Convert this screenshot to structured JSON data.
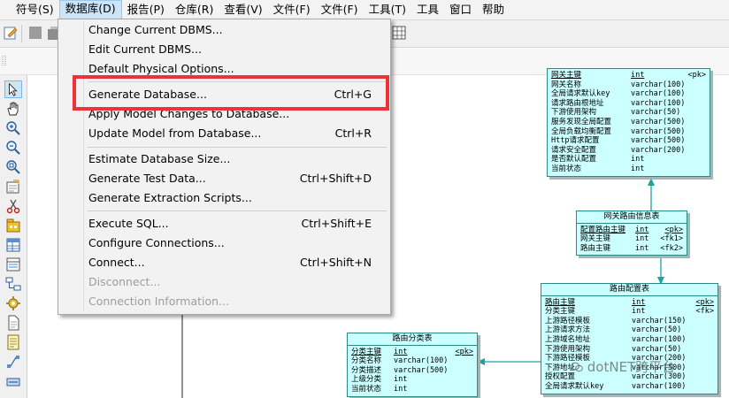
{
  "menubar": {
    "items": [
      {
        "label": "符号(S)"
      },
      {
        "label": "数据库(D)"
      },
      {
        "label": "报告(P)"
      },
      {
        "label": "仓库(R)"
      },
      {
        "label": "查看(V)"
      },
      {
        "label": "文件(F)"
      },
      {
        "label": "文件(F)"
      },
      {
        "label": "工具(T)"
      },
      {
        "label": "工具"
      },
      {
        "label": "窗口"
      },
      {
        "label": "帮助"
      }
    ]
  },
  "dropdown": {
    "items": [
      {
        "label": "Change Current DBMS...",
        "shortcut": ""
      },
      {
        "label": "Edit Current DBMS...",
        "shortcut": ""
      },
      {
        "label": "Default Physical Options...",
        "shortcut": ""
      },
      {
        "label": "Generate Database...",
        "shortcut": "Ctrl+G"
      },
      {
        "label": "Apply Model Changes to Database...",
        "shortcut": ""
      },
      {
        "label": "Update Model from Database...",
        "shortcut": "Ctrl+R"
      },
      {
        "label": "Estimate Database Size...",
        "shortcut": ""
      },
      {
        "label": "Generate Test Data...",
        "shortcut": "Ctrl+Shift+D"
      },
      {
        "label": "Generate Extraction Scripts...",
        "shortcut": ""
      },
      {
        "label": "Execute SQL...",
        "shortcut": "Ctrl+Shift+E"
      },
      {
        "label": "Configure Connections...",
        "shortcut": ""
      },
      {
        "label": "Connect...",
        "shortcut": "Ctrl+Shift+N"
      },
      {
        "label": "Disconnect...",
        "shortcut": ""
      },
      {
        "label": "Connection Information...",
        "shortcut": ""
      }
    ]
  },
  "tables": {
    "gateway": {
      "rows": [
        {
          "name": "网关主键",
          "type": "int",
          "key": "<pk>"
        },
        {
          "name": "网关名称",
          "type": "varchar(100)",
          "key": ""
        },
        {
          "name": "全局请求默认key",
          "type": "varchar(100)",
          "key": ""
        },
        {
          "name": "请求路由根地址",
          "type": "varchar(100)",
          "key": ""
        },
        {
          "name": "下游使用架构",
          "type": "varchar(50)",
          "key": ""
        },
        {
          "name": "服务发现全局配置",
          "type": "varchar(500)",
          "key": ""
        },
        {
          "name": "全局负载均衡配置",
          "type": "varchar(500)",
          "key": ""
        },
        {
          "name": "Http请求配置",
          "type": "varchar(500)",
          "key": ""
        },
        {
          "name": "请求安全配置",
          "type": "varchar(200)",
          "key": ""
        },
        {
          "name": "是否默认配置",
          "type": "int",
          "key": ""
        },
        {
          "name": "当前状态",
          "type": "int",
          "key": ""
        }
      ]
    },
    "gateway_route": {
      "title": "网关路由信息表",
      "rows": [
        {
          "name": "配置路由主键",
          "type": "int",
          "key": "<pk>"
        },
        {
          "name": "网关主键",
          "type": "int",
          "key": "<fk1>"
        },
        {
          "name": "路由主键",
          "type": "int",
          "key": "<fk2>"
        }
      ]
    },
    "route_config": {
      "title": "路由配置表",
      "rows": [
        {
          "name": "路由主键",
          "type": "int",
          "key": "<pk>"
        },
        {
          "name": "分类主键",
          "type": "int",
          "key": "<fk>"
        },
        {
          "name": "上游路径模板",
          "type": "varchar(150)",
          "key": ""
        },
        {
          "name": "上游请求方法",
          "type": "varchar(50)",
          "key": ""
        },
        {
          "name": "上游域名地址",
          "type": "varchar(100)",
          "key": ""
        },
        {
          "name": "下游使用架构",
          "type": "varchar(50)",
          "key": ""
        },
        {
          "name": "下游路径模板",
          "type": "varchar(200)",
          "key": ""
        },
        {
          "name": "下游地址",
          "type": "varchar(500)",
          "key": ""
        },
        {
          "name": "授权配置",
          "type": "varchar(300)",
          "key": ""
        },
        {
          "name": "全局请求默认key",
          "type": "varchar(100)",
          "key": ""
        }
      ]
    },
    "route_category": {
      "title": "路由分类表",
      "rows": [
        {
          "name": "分类主键",
          "type": "int",
          "key": "<pk>"
        },
        {
          "name": "分类名称",
          "type": "varchar(100)",
          "key": ""
        },
        {
          "name": "分类描述",
          "type": "varchar(500)",
          "key": ""
        },
        {
          "name": "上级分类",
          "type": "int",
          "key": ""
        },
        {
          "name": "当前状态",
          "type": "int",
          "key": ""
        }
      ]
    }
  },
  "watermark": {
    "text": "dotNET跨平台"
  },
  "colors": {
    "table_fill": "#ccffff",
    "table_border": "#2a8a8a",
    "connector": "#1aa3a3",
    "highlight_box": "#ee3236"
  }
}
